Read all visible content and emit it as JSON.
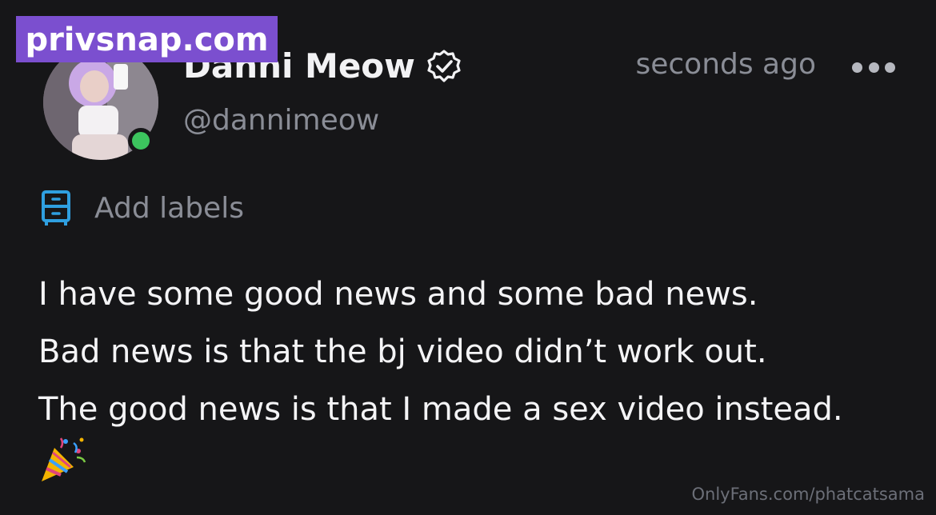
{
  "watermark": {
    "text": "privsnap.com"
  },
  "post": {
    "author_name": "Danni Meow",
    "author_handle": "@dannimeow",
    "timestamp": "seconds ago",
    "add_labels": "Add labels",
    "lines": [
      "I have some good news and some bad news.",
      "Bad news is that the bj video didn’t work out.",
      "The good news is that I made a sex video instead."
    ]
  },
  "footer": {
    "source": "OnlyFans.com/phatcatsama"
  },
  "icons": {
    "verified": "verified-badge-icon",
    "more": "more-options-icon",
    "labels": "labels-drawer-icon",
    "party": "party-popper-icon"
  },
  "colors": {
    "background": "#161618",
    "watermark_bg": "#7b4fcf",
    "online": "#3cc45e",
    "label_icon": "#2f9fe0",
    "muted_text": "#8a8d96"
  }
}
